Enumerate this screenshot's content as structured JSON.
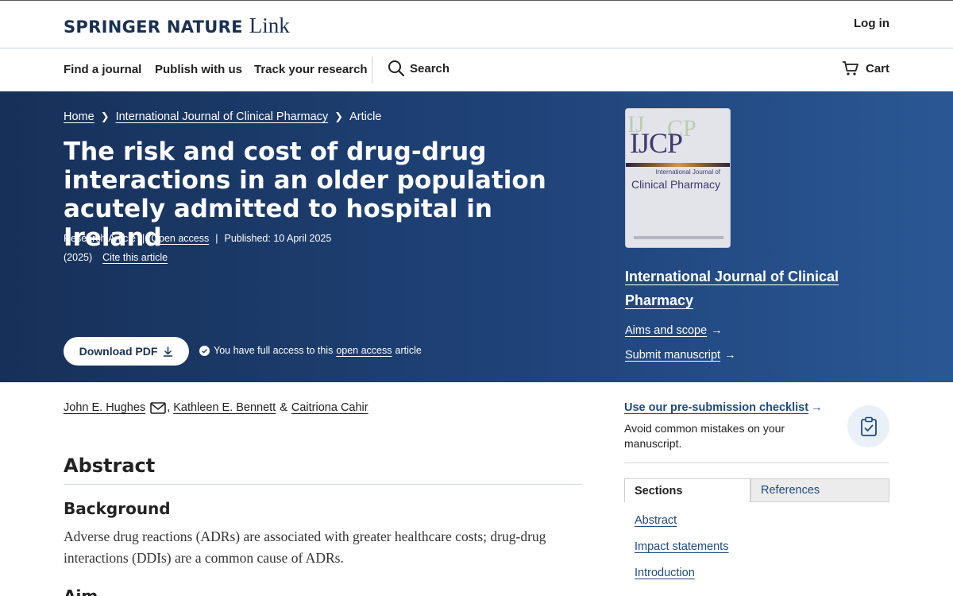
{
  "header": {
    "logo_main": "SPRINGER NATURE",
    "logo_sub": "Link",
    "login": "Log in"
  },
  "nav": {
    "items": [
      "Find a journal",
      "Publish with us",
      "Track your research"
    ],
    "search": "Search",
    "cart": "Cart"
  },
  "breadcrumb": {
    "home": "Home",
    "journal": "International Journal of Clinical Pharmacy",
    "current": "Article"
  },
  "article": {
    "title": "The risk and cost of drug-drug interactions in an older population acutely admitted to hospital in Ireland",
    "type": "Research Article",
    "access": "Open access",
    "published": "Published: 10 April 2025",
    "year": "(2025)",
    "cite": "Cite this article",
    "download": "Download PDF",
    "access_note_before": "You have full access to this",
    "access_note_link": "open access",
    "access_note_after": "article"
  },
  "cover": {
    "mark": "IJCP",
    "line1": "International Journal of",
    "line2": "Clinical Pharmacy"
  },
  "journal_side": {
    "name": "International Journal of Clinical Pharmacy",
    "aims": "Aims and scope",
    "submit": "Submit manuscript"
  },
  "authors": {
    "a1": "John E. Hughes",
    "a2": "Kathleen E. Bennett",
    "amp": "&",
    "a3": "Caitriona Cahir"
  },
  "abstract": {
    "heading": "Abstract",
    "background_heading": "Background",
    "background_text": "Adverse drug reactions (ADRs) are associated with greater healthcare costs; drug-drug interactions (DDIs) are a common cause of ADRs.",
    "aim_heading": "Aim"
  },
  "sidebar": {
    "checklist_link": "Use our pre-submission checklist",
    "checklist_desc": "Avoid common mistakes on your manuscript.",
    "tab_sections": "Sections",
    "tab_references": "References",
    "sections": [
      "Abstract",
      "Impact statements",
      "Introduction"
    ]
  },
  "icons": {
    "search": "search-icon",
    "cart": "cart-icon",
    "download": "download-icon",
    "check": "check-circle-icon",
    "mail": "mail-icon",
    "clipboard": "clipboard-check-icon"
  }
}
